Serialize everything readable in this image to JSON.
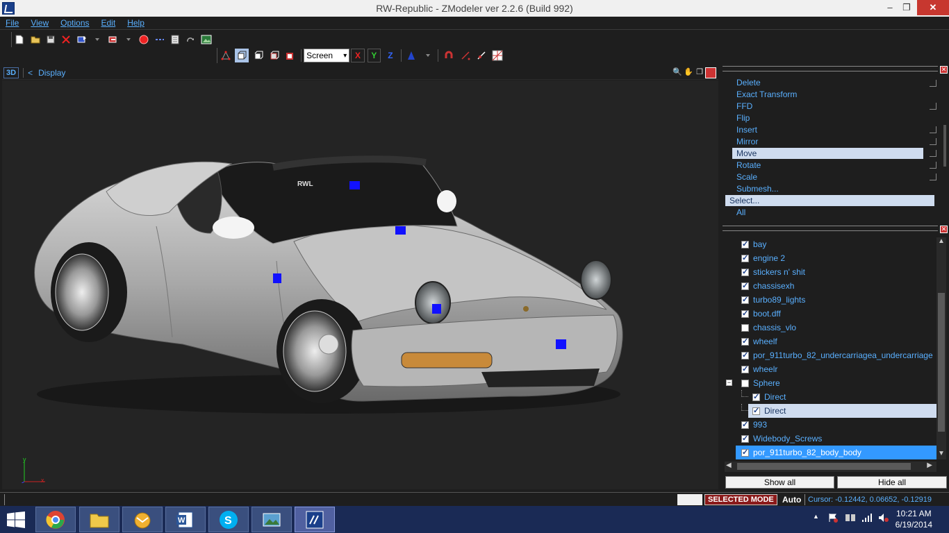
{
  "window": {
    "title": "RW-Republic - ZModeler ver 2.2.6 (Build 992)",
    "minimize": "‒",
    "maximize": "❐",
    "close": "✕"
  },
  "menu": [
    "File",
    "View",
    "Options",
    "Edit",
    "Help"
  ],
  "toolbar": {
    "screen_select": "Screen",
    "axis_x": "X",
    "axis_y": "Y",
    "axis_z": "Z"
  },
  "viewport": {
    "mode_label": "3D",
    "back_label": "<",
    "display_label": "Display",
    "gizmo": {
      "x": "x",
      "y": "y"
    }
  },
  "modifiers": {
    "items": [
      "Delete",
      "Exact Transform",
      "FFD",
      "Flip",
      "Insert",
      "Mirror",
      "Move",
      "Rotate",
      "Scale",
      "Submesh..."
    ],
    "selected": "Move",
    "select_row": "Select...",
    "all_row": "All"
  },
  "scene_tree": {
    "items": [
      {
        "label": "bay",
        "checked": true,
        "level": 0
      },
      {
        "label": "engine 2",
        "checked": true,
        "level": 0
      },
      {
        "label": "stickers n' shit",
        "checked": true,
        "level": 0
      },
      {
        "label": "chassisexh",
        "checked": true,
        "level": 0
      },
      {
        "label": "turbo89_lights",
        "checked": true,
        "level": 0
      },
      {
        "label": "boot.dff",
        "checked": true,
        "level": 0
      },
      {
        "label": "chassis_vlo",
        "checked": false,
        "level": 0
      },
      {
        "label": "wheelf",
        "checked": true,
        "level": 0
      },
      {
        "label": "por_911turbo_82_undercarriagea_undercarriage",
        "checked": true,
        "level": 0
      },
      {
        "label": "wheelr",
        "checked": true,
        "level": 0
      },
      {
        "label": "Sphere",
        "checked": false,
        "level": 0,
        "expander": "−"
      },
      {
        "label": "Direct",
        "checked": true,
        "level": 1
      },
      {
        "label": "Direct",
        "checked": true,
        "level": 1,
        "highlight": true
      },
      {
        "label": "993",
        "checked": true,
        "level": 0
      },
      {
        "label": "Widebody_Screws",
        "checked": true,
        "level": 0
      },
      {
        "label": "por_911turbo_82_body_body",
        "checked": true,
        "level": 0,
        "selected": true
      }
    ],
    "show_all": "Show all",
    "hide_all": "Hide all"
  },
  "statusbar": {
    "mode": "SELECTED MODE",
    "auto": "Auto",
    "cursor": "Cursor: -0.12442, 0.06652, -0.12919"
  },
  "taskbar": {
    "time": "10:21 AM",
    "date": "6/19/2014"
  },
  "colors": {
    "accent": "#5ab0ff",
    "background": "#1e1e1e",
    "selection": "#3399ff",
    "mode_badge": "#8b1a1a",
    "taskbar": "#1a2a55"
  }
}
